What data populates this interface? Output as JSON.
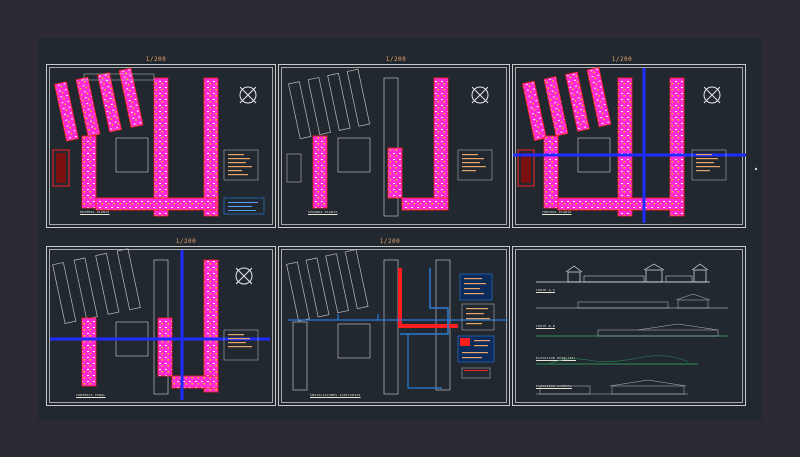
{
  "drawing": {
    "scale_labels": [
      "1/200",
      "1/200",
      "1/200",
      "1/200",
      "1/200"
    ],
    "plan_captions": [
      "PRIMERA PLANTA",
      "SEGUNDA PLANTA",
      "TERCERA PLANTA",
      "CUBIERTA FINAL",
      "INSTALACIONES SANITARIAS"
    ],
    "elevation_captions": [
      "CORTE A-A",
      "CORTE B-B",
      "ELEVACION PRINCIPAL",
      "ELEVACION LATERAL"
    ]
  },
  "colors": {
    "background": "#2c2a33",
    "viewport": "#212830",
    "frame": "#c9c9c9",
    "walls": "#ff2ad6",
    "wall_outline": "#ff2020",
    "axis_blue": "#1f2cff",
    "pipe_red": "#ff1e1e",
    "pipe_blue": "#2a7bd8",
    "text_orange": "#e6a36a"
  },
  "icons": [
    "north-arrow-icon",
    "compass-rose-icon"
  ]
}
